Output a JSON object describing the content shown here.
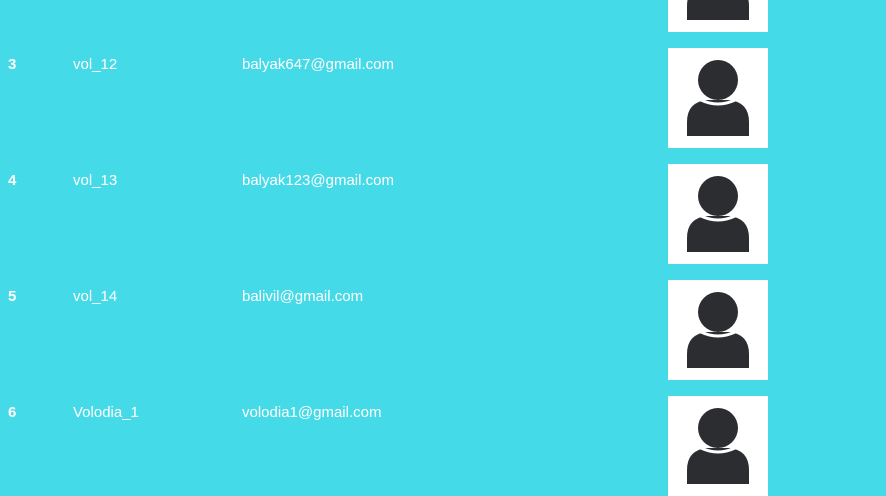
{
  "colors": {
    "background": "#45DAE8",
    "text": "#FFFFFF",
    "avatar_bg": "#FFFFFF",
    "avatar_figure": "#2B2D30"
  },
  "users_table": {
    "rows": [
      {
        "id": "3",
        "username": "vol_12",
        "email": "balyak647@gmail.com",
        "avatar_icon": "user-silhouette-icon"
      },
      {
        "id": "4",
        "username": "vol_13",
        "email": "balyak123@gmail.com",
        "avatar_icon": "user-silhouette-icon"
      },
      {
        "id": "5",
        "username": "vol_14",
        "email": "balivil@gmail.com",
        "avatar_icon": "user-silhouette-icon"
      },
      {
        "id": "6",
        "username": "Volodia_1",
        "email": "volodia1@gmail.com",
        "avatar_icon": "user-silhouette-icon"
      }
    ]
  }
}
